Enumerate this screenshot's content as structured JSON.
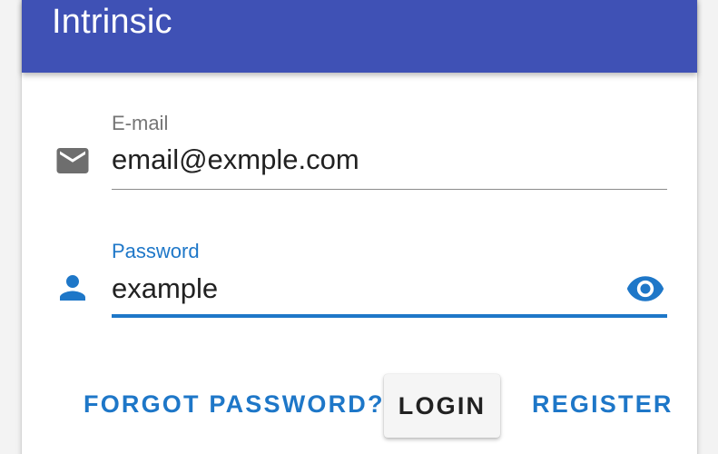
{
  "app": {
    "title": "Intrinsic",
    "accent_color": "#3f51b5",
    "focus_color": "#1e77c8"
  },
  "email_field": {
    "label": "E-mail",
    "value": "email@exmple.com",
    "icon": "mail-icon"
  },
  "password_field": {
    "label": "Password",
    "value": "example",
    "icon": "person-icon",
    "toggle_icon": "eye-icon",
    "focused": true
  },
  "actions": {
    "forgot_label": "FORGOT PASSWORD?",
    "login_label": "LOGIN",
    "register_label": "REGISTER"
  }
}
